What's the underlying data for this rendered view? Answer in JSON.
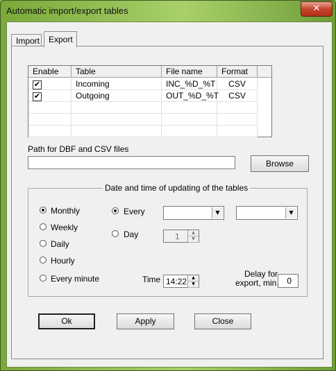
{
  "window": {
    "title": "Automatic import/export tables",
    "close_glyph": "✕"
  },
  "tabs": [
    {
      "label": "Import"
    },
    {
      "label": "Export"
    }
  ],
  "grid": {
    "columns": [
      "Enable",
      "Table",
      "File name",
      "Format"
    ],
    "rows": [
      {
        "enabled": true,
        "table": "Incoming",
        "file": "INC_%D_%T",
        "format": "CSV"
      },
      {
        "enabled": true,
        "table": "Outgoing",
        "file": "OUT_%D_%T",
        "format": "CSV"
      }
    ],
    "check_glyph": "✔"
  },
  "path": {
    "label": "Path for DBF and CSV files",
    "value": "",
    "browse_label": "Browse"
  },
  "schedule": {
    "title": "Date and time of updating of the tables",
    "options": [
      "Monthly",
      "Weekly",
      "Daily",
      "Hourly",
      "Every minute"
    ],
    "selected": "Monthly",
    "every_label": "Every",
    "day_label": "Day",
    "day_value": "1",
    "time_label": "Time",
    "time_value": "14:22",
    "delay_label_1": "Delay for",
    "delay_label_2": "export, min.",
    "delay_value": "0"
  },
  "buttons": {
    "ok": "Ok",
    "apply": "Apply",
    "close": "Close"
  }
}
